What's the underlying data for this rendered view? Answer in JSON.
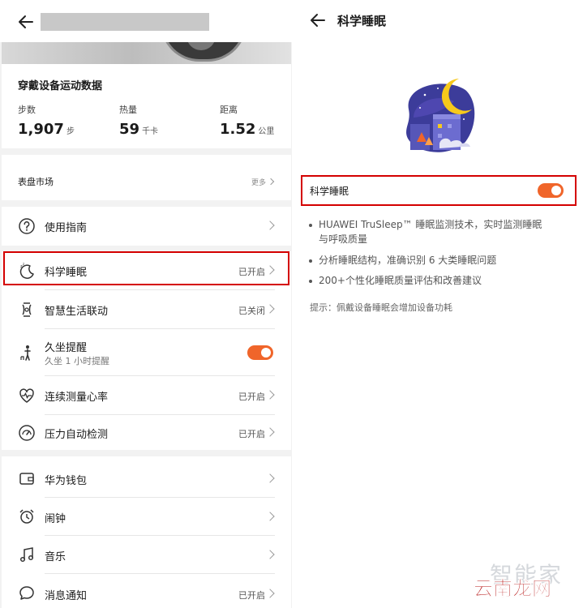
{
  "left": {
    "sport": {
      "title": "穿戴设备运动数据",
      "stats": [
        {
          "label": "步数",
          "value": "1,907",
          "unit": "步"
        },
        {
          "label": "热量",
          "value": "59",
          "unit": "千卡"
        },
        {
          "label": "距离",
          "value": "1.52",
          "unit": "公里"
        }
      ]
    },
    "market": {
      "title": "表盘市场",
      "more": "更多"
    },
    "items": [
      {
        "label": "使用指南",
        "icon": "question-circle-icon",
        "status": ""
      },
      {
        "label": "科学睡眠",
        "icon": "sleep-moon-icon",
        "status": "已开启"
      },
      {
        "label": "智慧生活联动",
        "icon": "watch-icon",
        "status": "已关闭"
      },
      {
        "label": "久坐提醒",
        "sublabel": "久坐 1 小时提醒",
        "icon": "standing-person-icon",
        "toggle_on": true
      },
      {
        "label": "连续测量心率",
        "icon": "heart-rate-icon",
        "status": "已开启"
      },
      {
        "label": "压力自动检测",
        "icon": "gauge-icon",
        "status": "已开启"
      },
      {
        "label": "华为钱包",
        "icon": "wallet-icon",
        "status": ""
      },
      {
        "label": "闹钟",
        "icon": "alarm-clock-icon",
        "status": ""
      },
      {
        "label": "音乐",
        "icon": "music-note-icon",
        "status": ""
      },
      {
        "label": "消息通知",
        "icon": "message-bubble-icon",
        "status": "已开启"
      }
    ]
  },
  "right": {
    "title": "科学睡眠",
    "setting": {
      "label": "科学睡眠",
      "toggle_on": true
    },
    "bullets": [
      "HUAWEI TruSleep™ 睡眠监测技术，实时监测睡眠",
      "与呼吸质量",
      "分析睡眠结构，准确识别 6 大类睡眠问题",
      "200+个性化睡眠质量评估和改善建议"
    ],
    "tip": "提示：佩戴设备睡眠会增加设备功耗"
  },
  "watermark": {
    "line1": "智能家",
    "line2": "云南龙网"
  },
  "colors": {
    "accent": "#f0652a",
    "highlight": "#d40000"
  }
}
